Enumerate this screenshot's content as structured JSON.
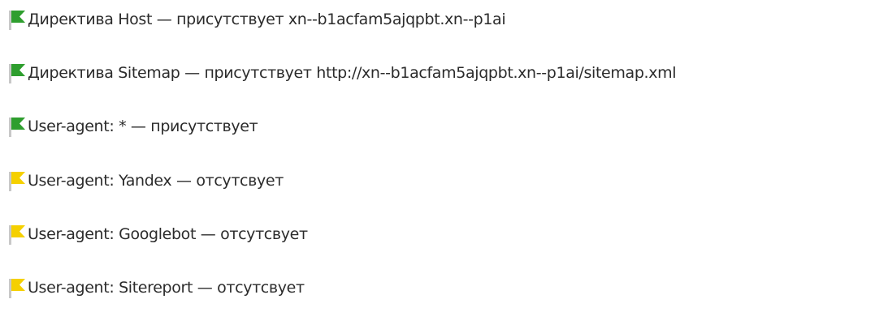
{
  "colors": {
    "ok_flag": "#2e9e2e",
    "warn_flag": "#f5d000",
    "pole": "#c8c8c8",
    "text": "#2b2b2b"
  },
  "checks": [
    {
      "status": "ok",
      "icon": "green-flag-icon",
      "text": "Директива Host — присутствует xn--b1acfam5ajqpbt.xn--p1ai"
    },
    {
      "status": "ok",
      "icon": "green-flag-icon",
      "text": "Директива Sitemap — присутствует http://xn--b1acfam5ajqpbt.xn--p1ai/sitemap.xml"
    },
    {
      "status": "ok",
      "icon": "green-flag-icon",
      "text": "User-agent: * — присутствует"
    },
    {
      "status": "warning",
      "icon": "yellow-flag-icon",
      "text": "User-agent: Yandex — отсутсвует"
    },
    {
      "status": "warning",
      "icon": "yellow-flag-icon",
      "text": "User-agent: Googlebot — отсутсвует"
    },
    {
      "status": "warning",
      "icon": "yellow-flag-icon",
      "text": "User-agent: Sitereport — отсутсвует"
    }
  ]
}
